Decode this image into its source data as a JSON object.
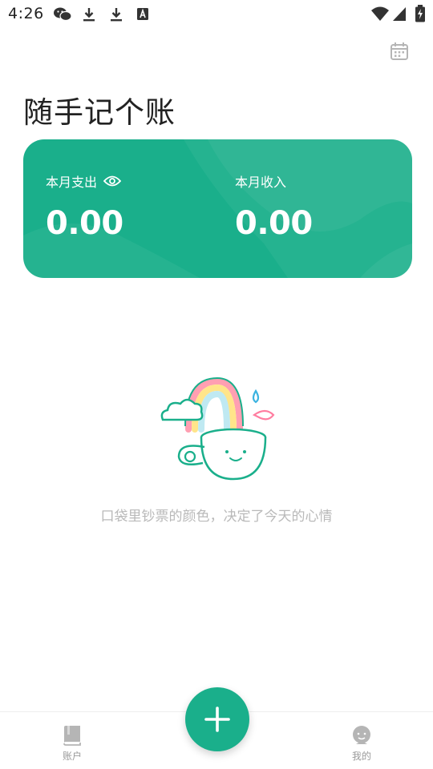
{
  "status_bar": {
    "time": "4:26",
    "left_icons": [
      "wechat-icon",
      "download-icon",
      "download-icon",
      "keyboard-a-icon"
    ],
    "right_icons": [
      "wifi-icon",
      "signal-icon",
      "battery-charging-icon"
    ]
  },
  "header": {
    "title": "随手记个账",
    "calendar_icon": "calendar-icon"
  },
  "summary": {
    "expense_label": "本月支出",
    "expense_value": "0.00",
    "income_label": "本月收入",
    "income_value": "0.00",
    "visibility_icon": "eye-icon"
  },
  "empty_state": {
    "illustration": "rainbow-cup-illustration",
    "message": "口袋里钞票的颜色，决定了今天的心情"
  },
  "bottom_nav": {
    "accounts_label": "账户",
    "mine_label": "我的",
    "add_icon": "plus-icon"
  },
  "colors": {
    "accent": "#1aaf8b",
    "muted_text": "#b9b9b9",
    "nav_icon": "#b5b5b5"
  }
}
